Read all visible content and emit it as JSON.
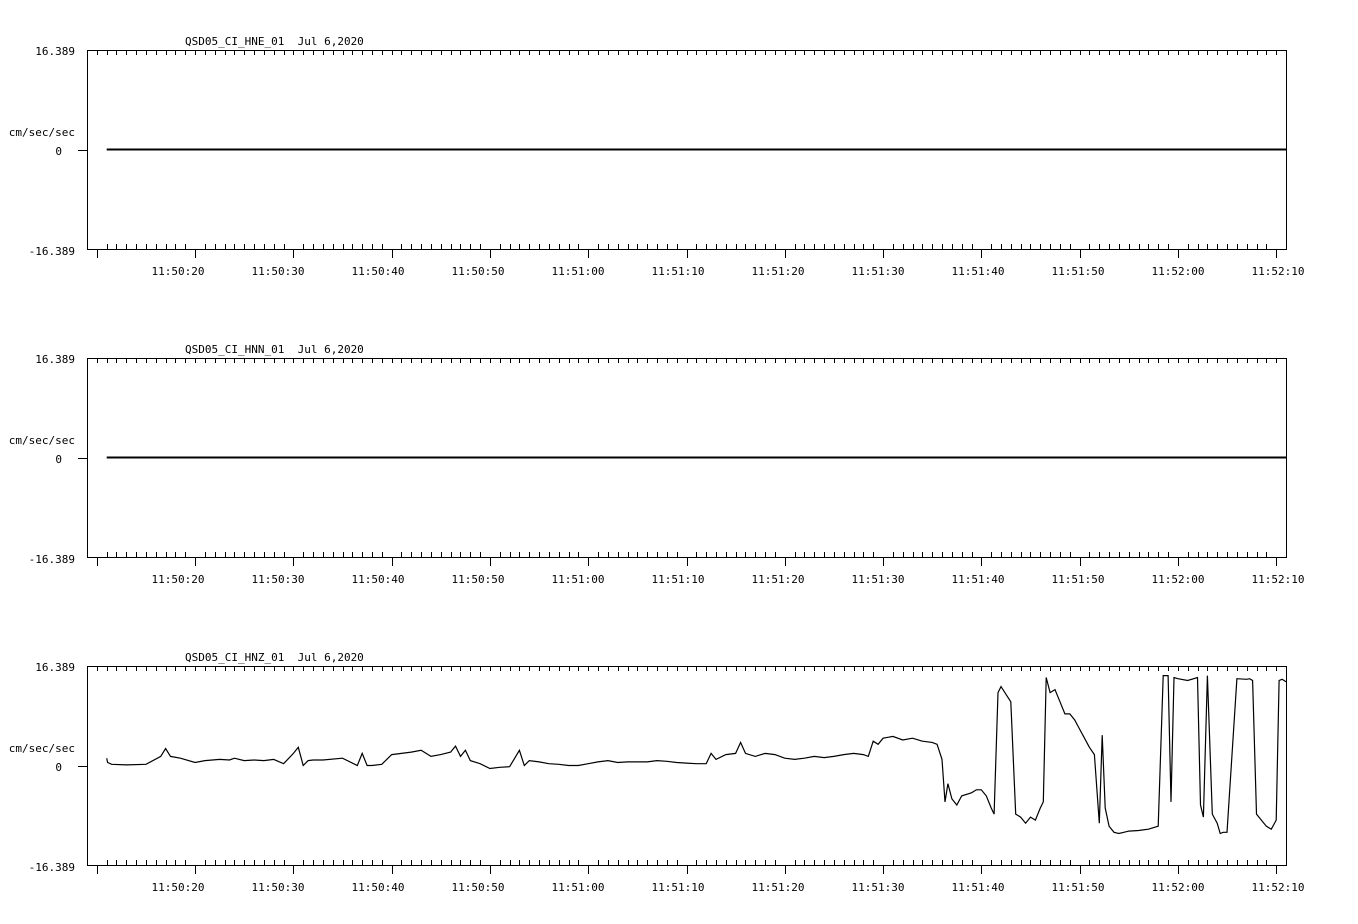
{
  "chart_data": [
    {
      "type": "line",
      "title": "QSD05_CI_HNE_01  Jul 6,2020",
      "ylabel": "cm/sec/sec",
      "ytick_labels": [
        "16.389",
        "0",
        "-16.389"
      ],
      "ylim": [
        -16.389,
        16.389
      ],
      "xlim_seconds": [
        9.0,
        131.0
      ],
      "xtick_labels": [
        "11:50:20",
        "11:50:30",
        "11:50:40",
        "11:50:50",
        "11:51:00",
        "11:51:10",
        "11:51:20",
        "11:51:30",
        "11:51:40",
        "11:51:50",
        "11:52:00",
        "11:52:10"
      ],
      "grid": false,
      "series": [
        {
          "x": [
            11,
            131
          ],
          "y": [
            0,
            0
          ]
        }
      ]
    },
    {
      "type": "line",
      "title": "QSD05_CI_HNN_01  Jul 6,2020",
      "ylabel": "cm/sec/sec",
      "ytick_labels": [
        "16.389",
        "0",
        "-16.389"
      ],
      "ylim": [
        -16.389,
        16.389
      ],
      "xlim_seconds": [
        9.0,
        131.0
      ],
      "xtick_labels": [
        "11:50:20",
        "11:50:30",
        "11:50:40",
        "11:50:50",
        "11:51:00",
        "11:51:10",
        "11:51:20",
        "11:51:30",
        "11:51:40",
        "11:51:50",
        "11:52:00",
        "11:52:10"
      ],
      "grid": false,
      "series": [
        {
          "x": [
            11,
            131
          ],
          "y": [
            0,
            0
          ]
        }
      ]
    },
    {
      "type": "line",
      "title": "QSD05_CI_HNZ_01  Jul 6,2020",
      "ylabel": "cm/sec/sec",
      "ytick_labels": [
        "16.389",
        "0",
        "-16.389"
      ],
      "ylim": [
        -16.389,
        16.389
      ],
      "xlim_seconds": [
        9.0,
        131.0
      ],
      "xtick_labels": [
        "11:50:20",
        "11:50:30",
        "11:50:40",
        "11:50:50",
        "11:51:00",
        "11:51:10",
        "11:51:20",
        "11:51:30",
        "11:51:40",
        "11:51:50",
        "11:52:00",
        "11:52:10"
      ],
      "grid": false,
      "series": [
        {
          "x": [
            11.0,
            11.1,
            11.5,
            13.0,
            15.0,
            16.5,
            17.0,
            17.5,
            18.5,
            20.0,
            21.0,
            22.5,
            23.5,
            24.0,
            25.0,
            26.0,
            27.0,
            28.0,
            29.0,
            30.0,
            30.5,
            31.0,
            31.5,
            32.0,
            33.0,
            35.0,
            36.5,
            37.0,
            37.5,
            38.0,
            39.0,
            40.0,
            41.0,
            42.0,
            43.0,
            44.0,
            45.0,
            46.0,
            46.5,
            47.0,
            47.5,
            48.0,
            49.0,
            50.0,
            51.0,
            52.0,
            53.0,
            53.5,
            54.0,
            55.0,
            56.0,
            57.0,
            58.0,
            59.0,
            60.0,
            61.0,
            62.0,
            63.0,
            64.0,
            65.0,
            66.0,
            67.0,
            68.0,
            69.0,
            70.0,
            71.0,
            72.0,
            72.5,
            73.0,
            74.0,
            75.0,
            75.5,
            76.0,
            77.0,
            78.0,
            79.0,
            80.0,
            81.0,
            82.0,
            83.0,
            84.0,
            85.0,
            86.0,
            87.0,
            88.0,
            88.5,
            89.0,
            89.5,
            90.0,
            91.0,
            92.0,
            93.0,
            94.0,
            95.0,
            95.5,
            96.0,
            96.3,
            96.6,
            97.0,
            97.5,
            98.0,
            99.0,
            99.5,
            100.0,
            100.5,
            101.0,
            101.3,
            101.7,
            102.0,
            103.0,
            103.5,
            104.0,
            104.5,
            105.0,
            105.5,
            106.0,
            106.3,
            106.6,
            107.0,
            107.5,
            108.0,
            108.5,
            109.0,
            109.5,
            110.0,
            110.5,
            111.0,
            111.5,
            112.0,
            112.3,
            112.6,
            113.0,
            113.5,
            114.0,
            114.5,
            115.0,
            116.0,
            117.0,
            118.0,
            118.5,
            119.0,
            119.3,
            119.6,
            120.0,
            121.0,
            122.0,
            122.3,
            122.6,
            123.0,
            123.5,
            124.0,
            124.3,
            124.6,
            125.0,
            126.0,
            127.0,
            127.3,
            127.6,
            128.0,
            129.0,
            129.5,
            130.0,
            130.3,
            130.6,
            131.0
          ],
          "y": [
            1.2,
            0.5,
            0.2,
            0.1,
            0.2,
            1.5,
            2.8,
            1.5,
            1.2,
            0.5,
            0.8,
            1.0,
            0.9,
            1.2,
            0.8,
            0.9,
            0.8,
            1.0,
            0.3,
            2.0,
            3.0,
            0.0,
            0.8,
            0.9,
            0.9,
            1.2,
            0.0,
            2.0,
            0.0,
            0.0,
            0.2,
            1.8,
            2.0,
            2.2,
            2.5,
            1.5,
            1.8,
            2.2,
            3.2,
            1.5,
            2.5,
            0.8,
            0.3,
            -0.5,
            -0.3,
            -0.2,
            2.5,
            0.0,
            0.8,
            0.6,
            0.3,
            0.2,
            0.0,
            0.0,
            0.3,
            0.6,
            0.8,
            0.5,
            0.6,
            0.6,
            0.6,
            0.8,
            0.7,
            0.5,
            0.4,
            0.3,
            0.3,
            2.0,
            1.0,
            1.8,
            2.0,
            3.8,
            2.0,
            1.5,
            2.0,
            1.8,
            1.2,
            1.0,
            1.2,
            1.5,
            1.3,
            1.5,
            1.8,
            2.0,
            1.8,
            1.5,
            4.0,
            3.5,
            4.5,
            4.8,
            4.2,
            4.5,
            4.0,
            3.8,
            3.5,
            1.0,
            -6.0,
            -3.0,
            -5.5,
            -6.5,
            -5.0,
            -4.5,
            -4.0,
            -4.0,
            -5.0,
            -7.0,
            -8.0,
            12.0,
            13.0,
            10.5,
            -8.0,
            -8.5,
            -9.5,
            -8.5,
            -9.0,
            -7.0,
            -6.0,
            14.5,
            12.0,
            12.5,
            10.5,
            8.5,
            8.5,
            7.5,
            6.0,
            4.5,
            3.0,
            1.8,
            -9.5,
            5.0,
            -7.0,
            -10.0,
            -11.0,
            -11.2,
            -11.0,
            -10.8,
            -10.7,
            -10.5,
            -10.0,
            14.8,
            14.8,
            -6.0,
            14.5,
            14.3,
            14.0,
            14.5,
            -6.5,
            -8.5,
            14.8,
            -8.0,
            -9.5,
            -11.2,
            -11.0,
            -11.0,
            14.3,
            14.2,
            14.3,
            14.0,
            -8.0,
            -10.0,
            -10.5,
            -9.0,
            14.0,
            14.2,
            13.8
          ]
        }
      ]
    }
  ]
}
